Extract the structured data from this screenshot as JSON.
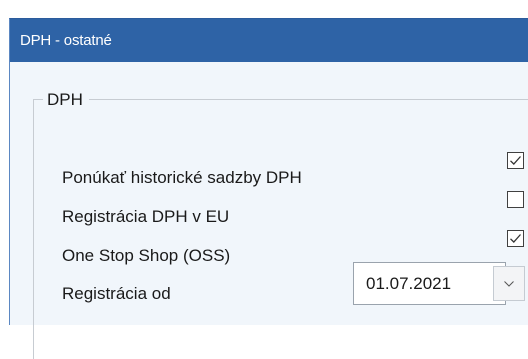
{
  "window": {
    "title": "DPH - ostatné"
  },
  "group": {
    "legend": "DPH"
  },
  "rows": [
    {
      "label": "Ponúkať historické sadzby DPH",
      "checked": true
    },
    {
      "label": "Registrácia DPH v EU",
      "checked": false
    },
    {
      "label": "One Stop Shop (OSS)",
      "checked": true
    }
  ],
  "registration": {
    "label": "Registrácia od",
    "date_value": "01.07.2021",
    "dropdown_icon": "chevron-down-icon"
  },
  "colors": {
    "titlebar": "#2e63a6",
    "panel_background": "#f1f6fb"
  }
}
